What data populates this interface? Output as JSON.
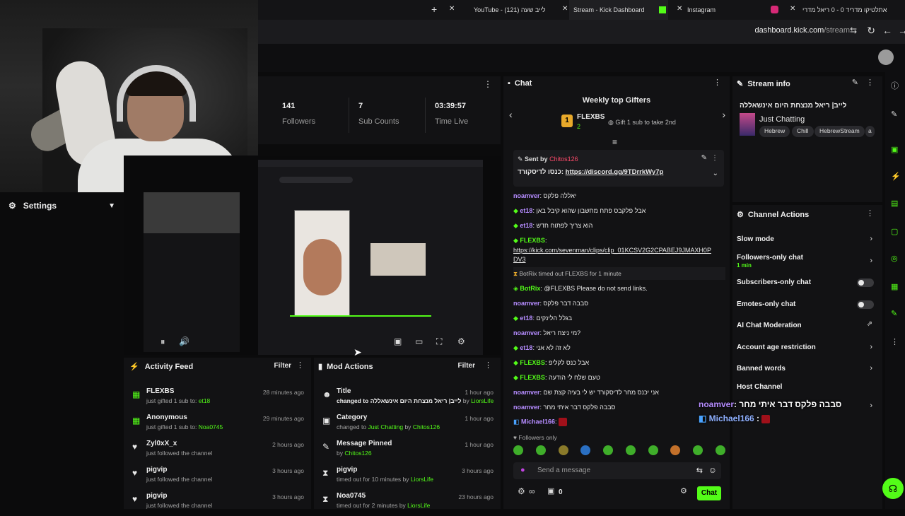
{
  "browser": {
    "tabs": [
      {
        "label": "YouTube - לייב שעה (121)",
        "active": false
      },
      {
        "label": "Stream - Kick Dashboard",
        "active": true
      },
      {
        "label": "Instagram",
        "active": false
      },
      {
        "label": "אתלטיקו מדריד 0 - 0 ריאל מדרי",
        "active": false
      }
    ],
    "url_host": "dashboard.kick.com",
    "url_path": "/stream"
  },
  "settings": {
    "label": "Settings"
  },
  "stats": [
    {
      "value": "141",
      "label": "Followers"
    },
    {
      "value": "7",
      "label": "Sub Counts"
    },
    {
      "value": "03:39:57",
      "label": "Time Live"
    }
  ],
  "activity": {
    "title": "Activity Feed",
    "filter": "Filter",
    "items": [
      {
        "name": "FLEXBS",
        "text": "just gifted 1 sub to:",
        "target": "et18",
        "time": "28 minutes ago",
        "icon": "gift-icon"
      },
      {
        "name": "Anonymous",
        "text": "just gifted 1 sub to:",
        "target": "Noa0745",
        "time": "29 minutes ago",
        "icon": "gift-icon"
      },
      {
        "name": "Zyl0xX_x",
        "text": "just followed the channel",
        "target": "",
        "time": "2 hours ago",
        "icon": "heart-icon"
      },
      {
        "name": "pigvip",
        "text": "just followed the channel",
        "target": "",
        "time": "3 hours ago",
        "icon": "heart-icon"
      },
      {
        "name": "pigvip",
        "text": "just followed the channel",
        "target": "",
        "time": "3 hours ago",
        "icon": "heart-icon"
      }
    ]
  },
  "mod": {
    "title": "Mod Actions",
    "filter": "Filter",
    "items": [
      {
        "name": "Title",
        "text": "changed to לייב| ריאל מנצחת היום אינשאללה",
        "by": "by",
        "target": "LiorsLife",
        "time": "1 hour ago"
      },
      {
        "name": "Category",
        "text": "changed to",
        "by": "",
        "target": "Just Chatting",
        "by2": "by",
        "target2": "Chitos126",
        "time": "1 hour ago"
      },
      {
        "name": "Message Pinned",
        "text": "by",
        "by": "",
        "target": "Chitos126",
        "time": "1 hour ago"
      },
      {
        "name": "pigvip",
        "text": "timed out for 10 minutes by",
        "by": "",
        "target": "LiorsLife",
        "time": "3 hours ago"
      },
      {
        "name": "Noa0745",
        "text": "timed out for 2 minutes by",
        "by": "",
        "target": "LiorsLife",
        "time": "23 hours ago"
      }
    ]
  },
  "chat": {
    "title": "Chat",
    "gifters_title": "Weekly top Gifters",
    "top_gifter": "FLEXBS",
    "top_gifter_count": "2",
    "rank": "1",
    "gift_hint": "Gift 1 sub to take 2nd",
    "pinned_by_label": "Sent by",
    "pinned_by": "Chitos126",
    "pinned_text": "כנסו לדיסקורד:",
    "pinned_link": "https://discord.gg/9TDrrkWy7p",
    "messages": [
      {
        "user": "noamver",
        "text": "יאללה פלקס",
        "color": "pur"
      },
      {
        "user": "et18",
        "text": "אבל פלקבס פתח מחשבון שהוא קיבל באן",
        "color": "pur"
      },
      {
        "user": "et18",
        "text": "הוא צריך לפתוח חדש",
        "color": "pur"
      },
      {
        "user": "FLEXBS",
        "text": "",
        "color": "grn"
      },
      {
        "user": "",
        "text": "https://kick.com/sevenman/clips/clip_01KCSV2G2CPABEJ9JMAXH0P",
        "color": "link"
      },
      {
        "user": "",
        "text": "DV3",
        "color": "link"
      },
      {
        "user": "BotRix",
        "text": "@FLEXBS Please do not send links.",
        "color": "grn"
      },
      {
        "user": "noamver",
        "text": "סבבה דבר פלקס",
        "color": "pur"
      },
      {
        "user": "et18",
        "text": "בגלל הלינקים",
        "color": "pur"
      },
      {
        "user": "noamver",
        "text": "מי ניצח ריאל?",
        "color": "pur"
      },
      {
        "user": "et18",
        "text": "לא זה לא אני",
        "color": "pur"
      },
      {
        "user": "FLEXBS",
        "text": "אבל כנס לקליפ",
        "color": "grn"
      },
      {
        "user": "FLEXBS",
        "text": "טעם שלח לי הודעה",
        "color": "grn"
      },
      {
        "user": "noamver",
        "text": "אני יכנס מחר לדיסקורד יש לי בעיה קצת שם",
        "color": "pur"
      },
      {
        "user": "noamver",
        "text": "סבבה פלקס דבר איתי מחר",
        "color": "pur"
      },
      {
        "user": "Michael166",
        "text": "",
        "color": "pur"
      }
    ],
    "timeout_sys": "BotRix timed out FLEXBS for 1 minute",
    "followers_only": "Followers only",
    "placeholder": "Send a message",
    "count": "0",
    "send": "Chat"
  },
  "info": {
    "title": "Stream info",
    "stream_title": "לייב| ריאל מנצחת היום אינשאללה",
    "category": "Just Chatting",
    "tags": [
      "Hebrew",
      "Chill",
      "HebrewStream",
      "a"
    ]
  },
  "actions": {
    "title": "Channel Actions",
    "items": [
      {
        "label": "Slow mode",
        "sub": "",
        "kind": "chevron"
      },
      {
        "label": "Followers-only chat",
        "sub": "1 min",
        "kind": "chevron"
      },
      {
        "label": "Subscribers-only chat",
        "sub": "",
        "kind": "toggle"
      },
      {
        "label": "Emotes-only chat",
        "sub": "",
        "kind": "toggle"
      },
      {
        "label": "AI Chat Moderation",
        "sub": "",
        "kind": "external"
      },
      {
        "label": "Account age restriction",
        "sub": "",
        "kind": "chevron"
      },
      {
        "label": "Banned words",
        "sub": "",
        "kind": "chevron"
      },
      {
        "label": "Host Channel",
        "sub": "",
        "kind": "none"
      }
    ]
  },
  "overlay": {
    "user1": "noamver",
    "text1": "סבבה פלקס דבר איתי מחר",
    "user2": "Michael166"
  },
  "colors": {
    "accent": "#53fc18",
    "purple": "#b58cff",
    "bg": "#0b0b0c",
    "panel": "#121214"
  }
}
